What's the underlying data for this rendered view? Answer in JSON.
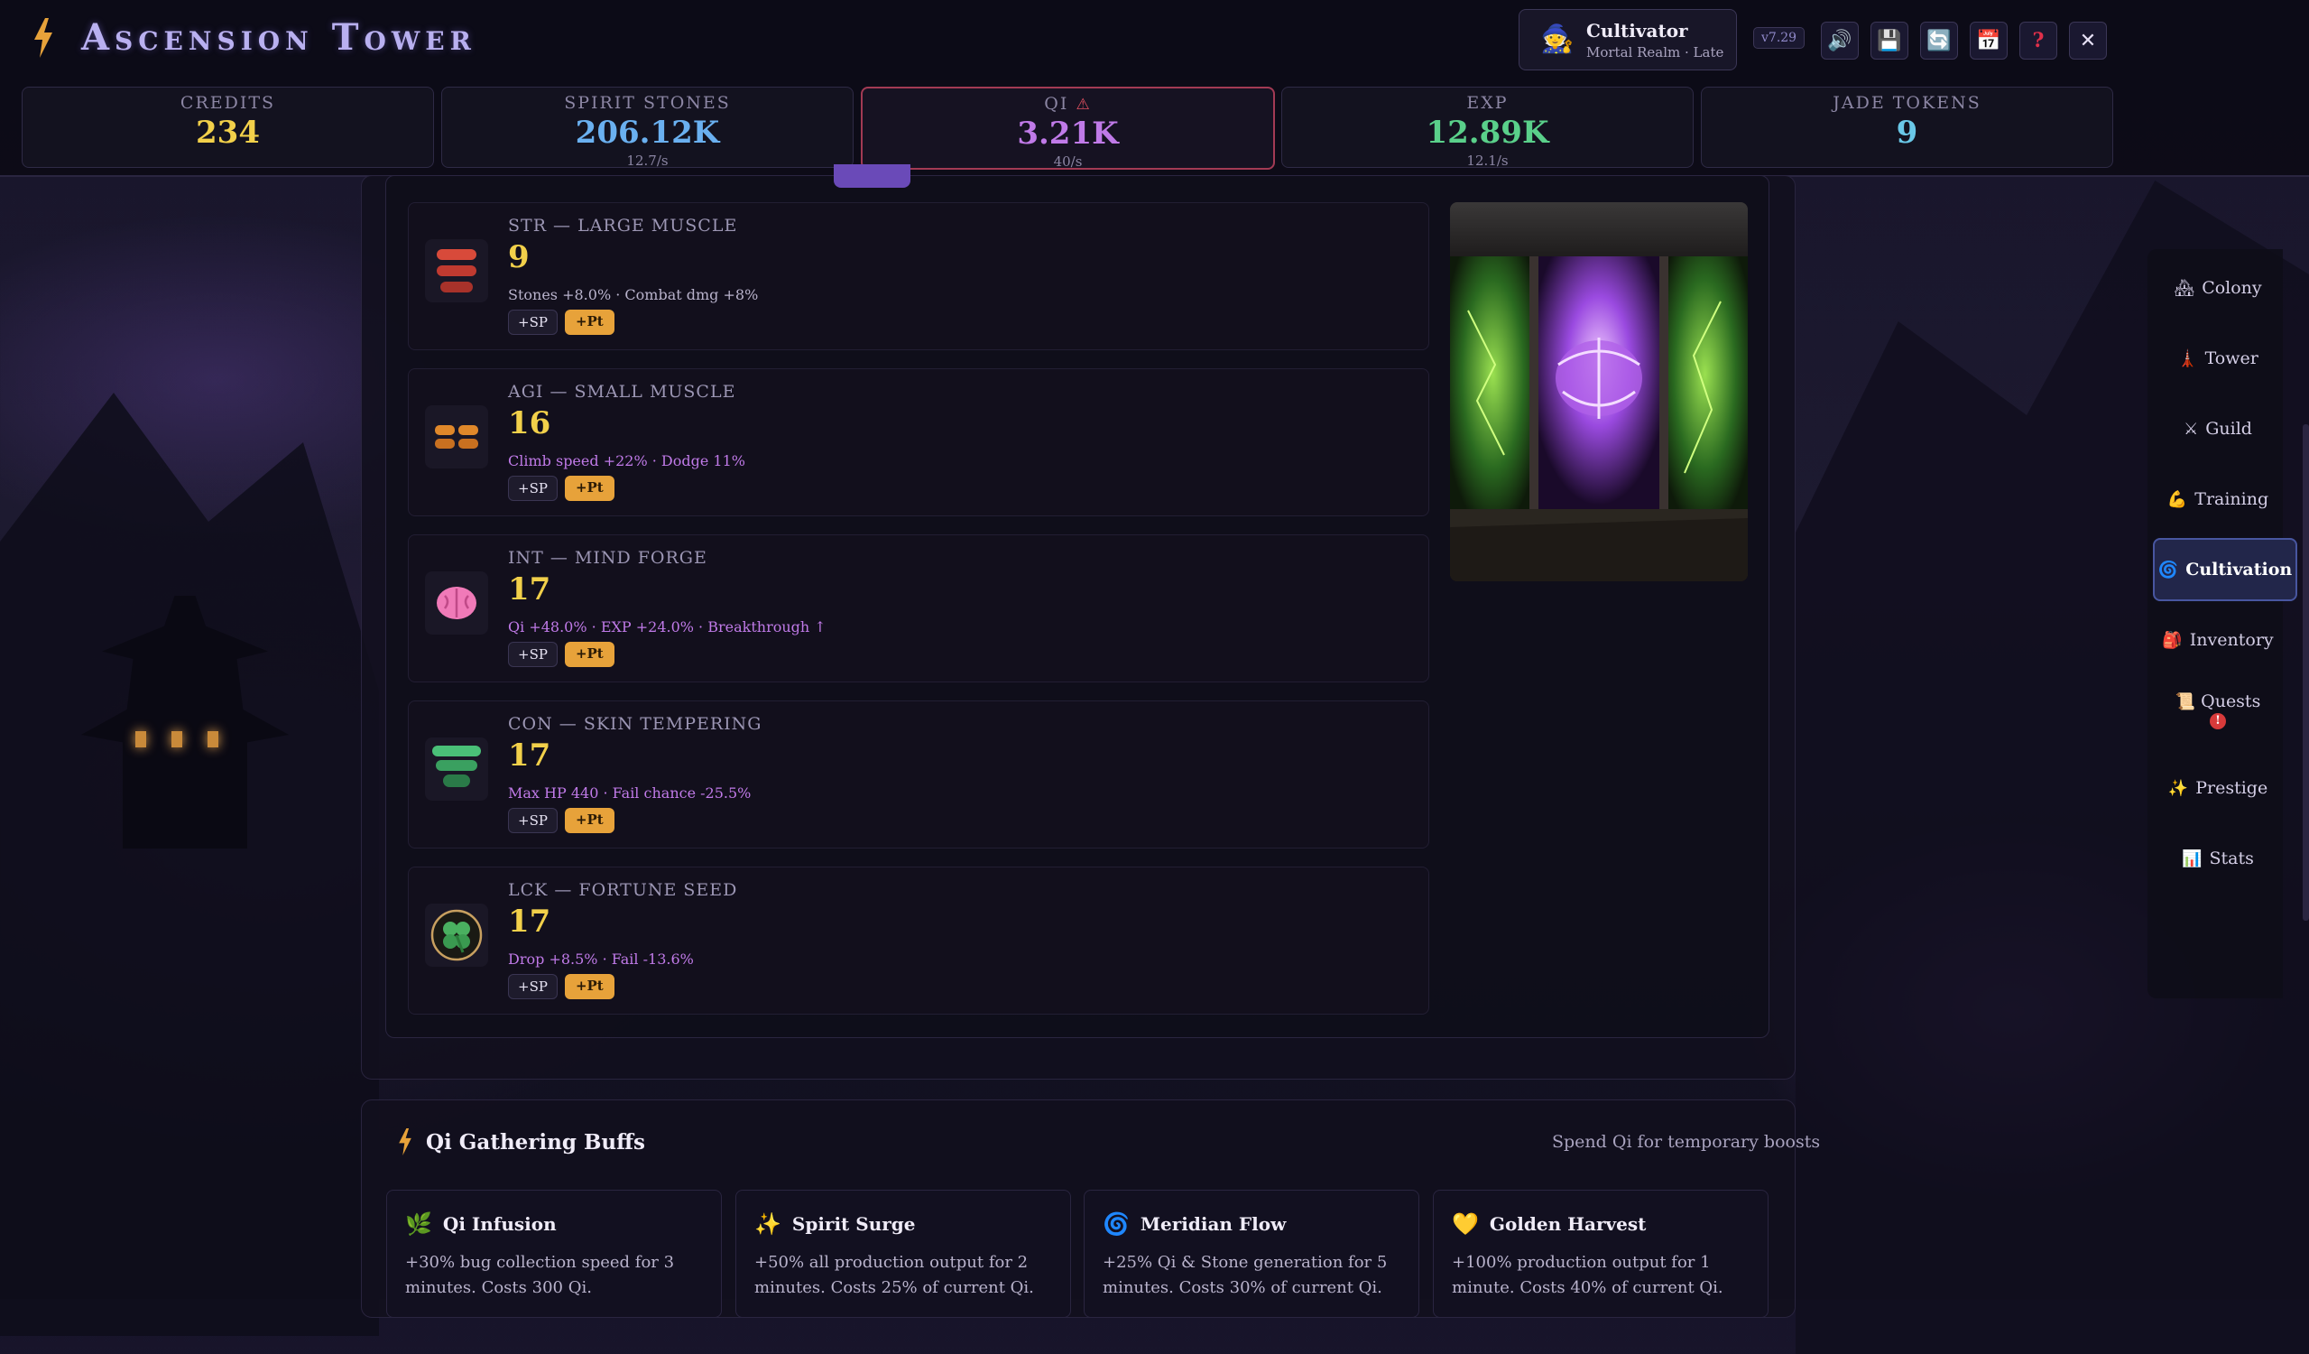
{
  "app": {
    "title": "Ascension Tower"
  },
  "profile": {
    "name": "Cultivator",
    "realm": "Mortal Realm · Late"
  },
  "version": "v7.29",
  "resources": [
    {
      "label": "Credits",
      "value": "234",
      "rate": "",
      "color": "#f2d04a"
    },
    {
      "label": "Spirit Stones",
      "value": "206.12K",
      "rate": "12.7/s",
      "color": "#6ab0f0"
    },
    {
      "label": "Qi",
      "value": "3.21K",
      "rate": "40/s",
      "color": "#c07ae8",
      "warning": "⚠"
    },
    {
      "label": "EXP",
      "value": "12.89K",
      "rate": "12.1/s",
      "color": "#5ad08a"
    },
    {
      "label": "Jade Tokens",
      "value": "9",
      "rate": "",
      "color": "#6ac8e8"
    }
  ],
  "stats": [
    {
      "title": "STR — Large Muscle",
      "value": "9",
      "desc": "Stones +8.0% · Combat dmg +8%",
      "desc_color": "#b9b3cc",
      "sp": "+SP",
      "pt": "+Pt"
    },
    {
      "title": "AGI — Small Muscle",
      "value": "16",
      "desc": "Climb speed +22% · Dodge 11%",
      "desc_color": "#c07ae8",
      "sp": "+SP",
      "pt": "+Pt"
    },
    {
      "title": "INT — Mind Forge",
      "value": "17",
      "desc": "Qi +48.0% · EXP +24.0% · Breakthrough ↑",
      "desc_color": "#c07ae8",
      "sp": "+SP",
      "pt": "+Pt"
    },
    {
      "title": "CON — Skin Tempering",
      "value": "17",
      "desc": "Max HP 440 · Fail chance -25.5%",
      "desc_color": "#c07ae8",
      "sp": "+SP",
      "pt": "+Pt"
    },
    {
      "title": "LCK — Fortune Seed",
      "value": "17",
      "desc": "Drop +8.5% · Fail -13.6%",
      "desc_color": "#c07ae8",
      "sp": "+SP",
      "pt": "+Pt"
    }
  ],
  "nav": [
    {
      "label": "Colony",
      "icon": "colony-icon",
      "glyph": "🏘"
    },
    {
      "label": "Tower",
      "icon": "tower-icon",
      "glyph": "🗼"
    },
    {
      "label": "Guild",
      "icon": "crossed-swords-icon",
      "glyph": "⚔"
    },
    {
      "label": "Training",
      "icon": "flexed-arm-icon",
      "glyph": "💪"
    },
    {
      "label": "Cultivation",
      "icon": "spiral-icon",
      "glyph": "🌀",
      "active": true
    },
    {
      "label": "Inventory",
      "icon": "backpack-icon",
      "glyph": "🎒"
    },
    {
      "label": "Quests",
      "icon": "scroll-icon",
      "glyph": "📜",
      "badge": "!"
    },
    {
      "label": "Prestige",
      "icon": "sparkles-icon",
      "glyph": "✨"
    },
    {
      "label": "Stats",
      "icon": "bar-chart-icon",
      "glyph": "📊"
    }
  ],
  "buffs": {
    "title": "Qi Gathering Buffs",
    "subtitle": "Spend Qi for temporary boosts",
    "items": [
      {
        "name": "Qi Infusion",
        "icon": "herb-icon",
        "glyph": "🌿",
        "desc": "+30% bug collection speed for 3 minutes. Costs 300 Qi."
      },
      {
        "name": "Spirit Surge",
        "icon": "sparkles-icon",
        "glyph": "✨",
        "desc": "+50% all production output for 2 minutes. Costs 25% of current Qi."
      },
      {
        "name": "Meridian Flow",
        "icon": "spiral-icon",
        "glyph": "🌀",
        "desc": "+25% Qi & Stone generation for 5 minutes. Costs 30% of current Qi."
      },
      {
        "name": "Golden Harvest",
        "icon": "gold-heart-icon",
        "glyph": "💛",
        "desc": "+100% production output for 1 minute. Costs 40% of current Qi."
      }
    ]
  },
  "colors": {
    "accent": "#e7a23a",
    "active_border": "#a23a54",
    "nav_active": "#4856a0"
  }
}
